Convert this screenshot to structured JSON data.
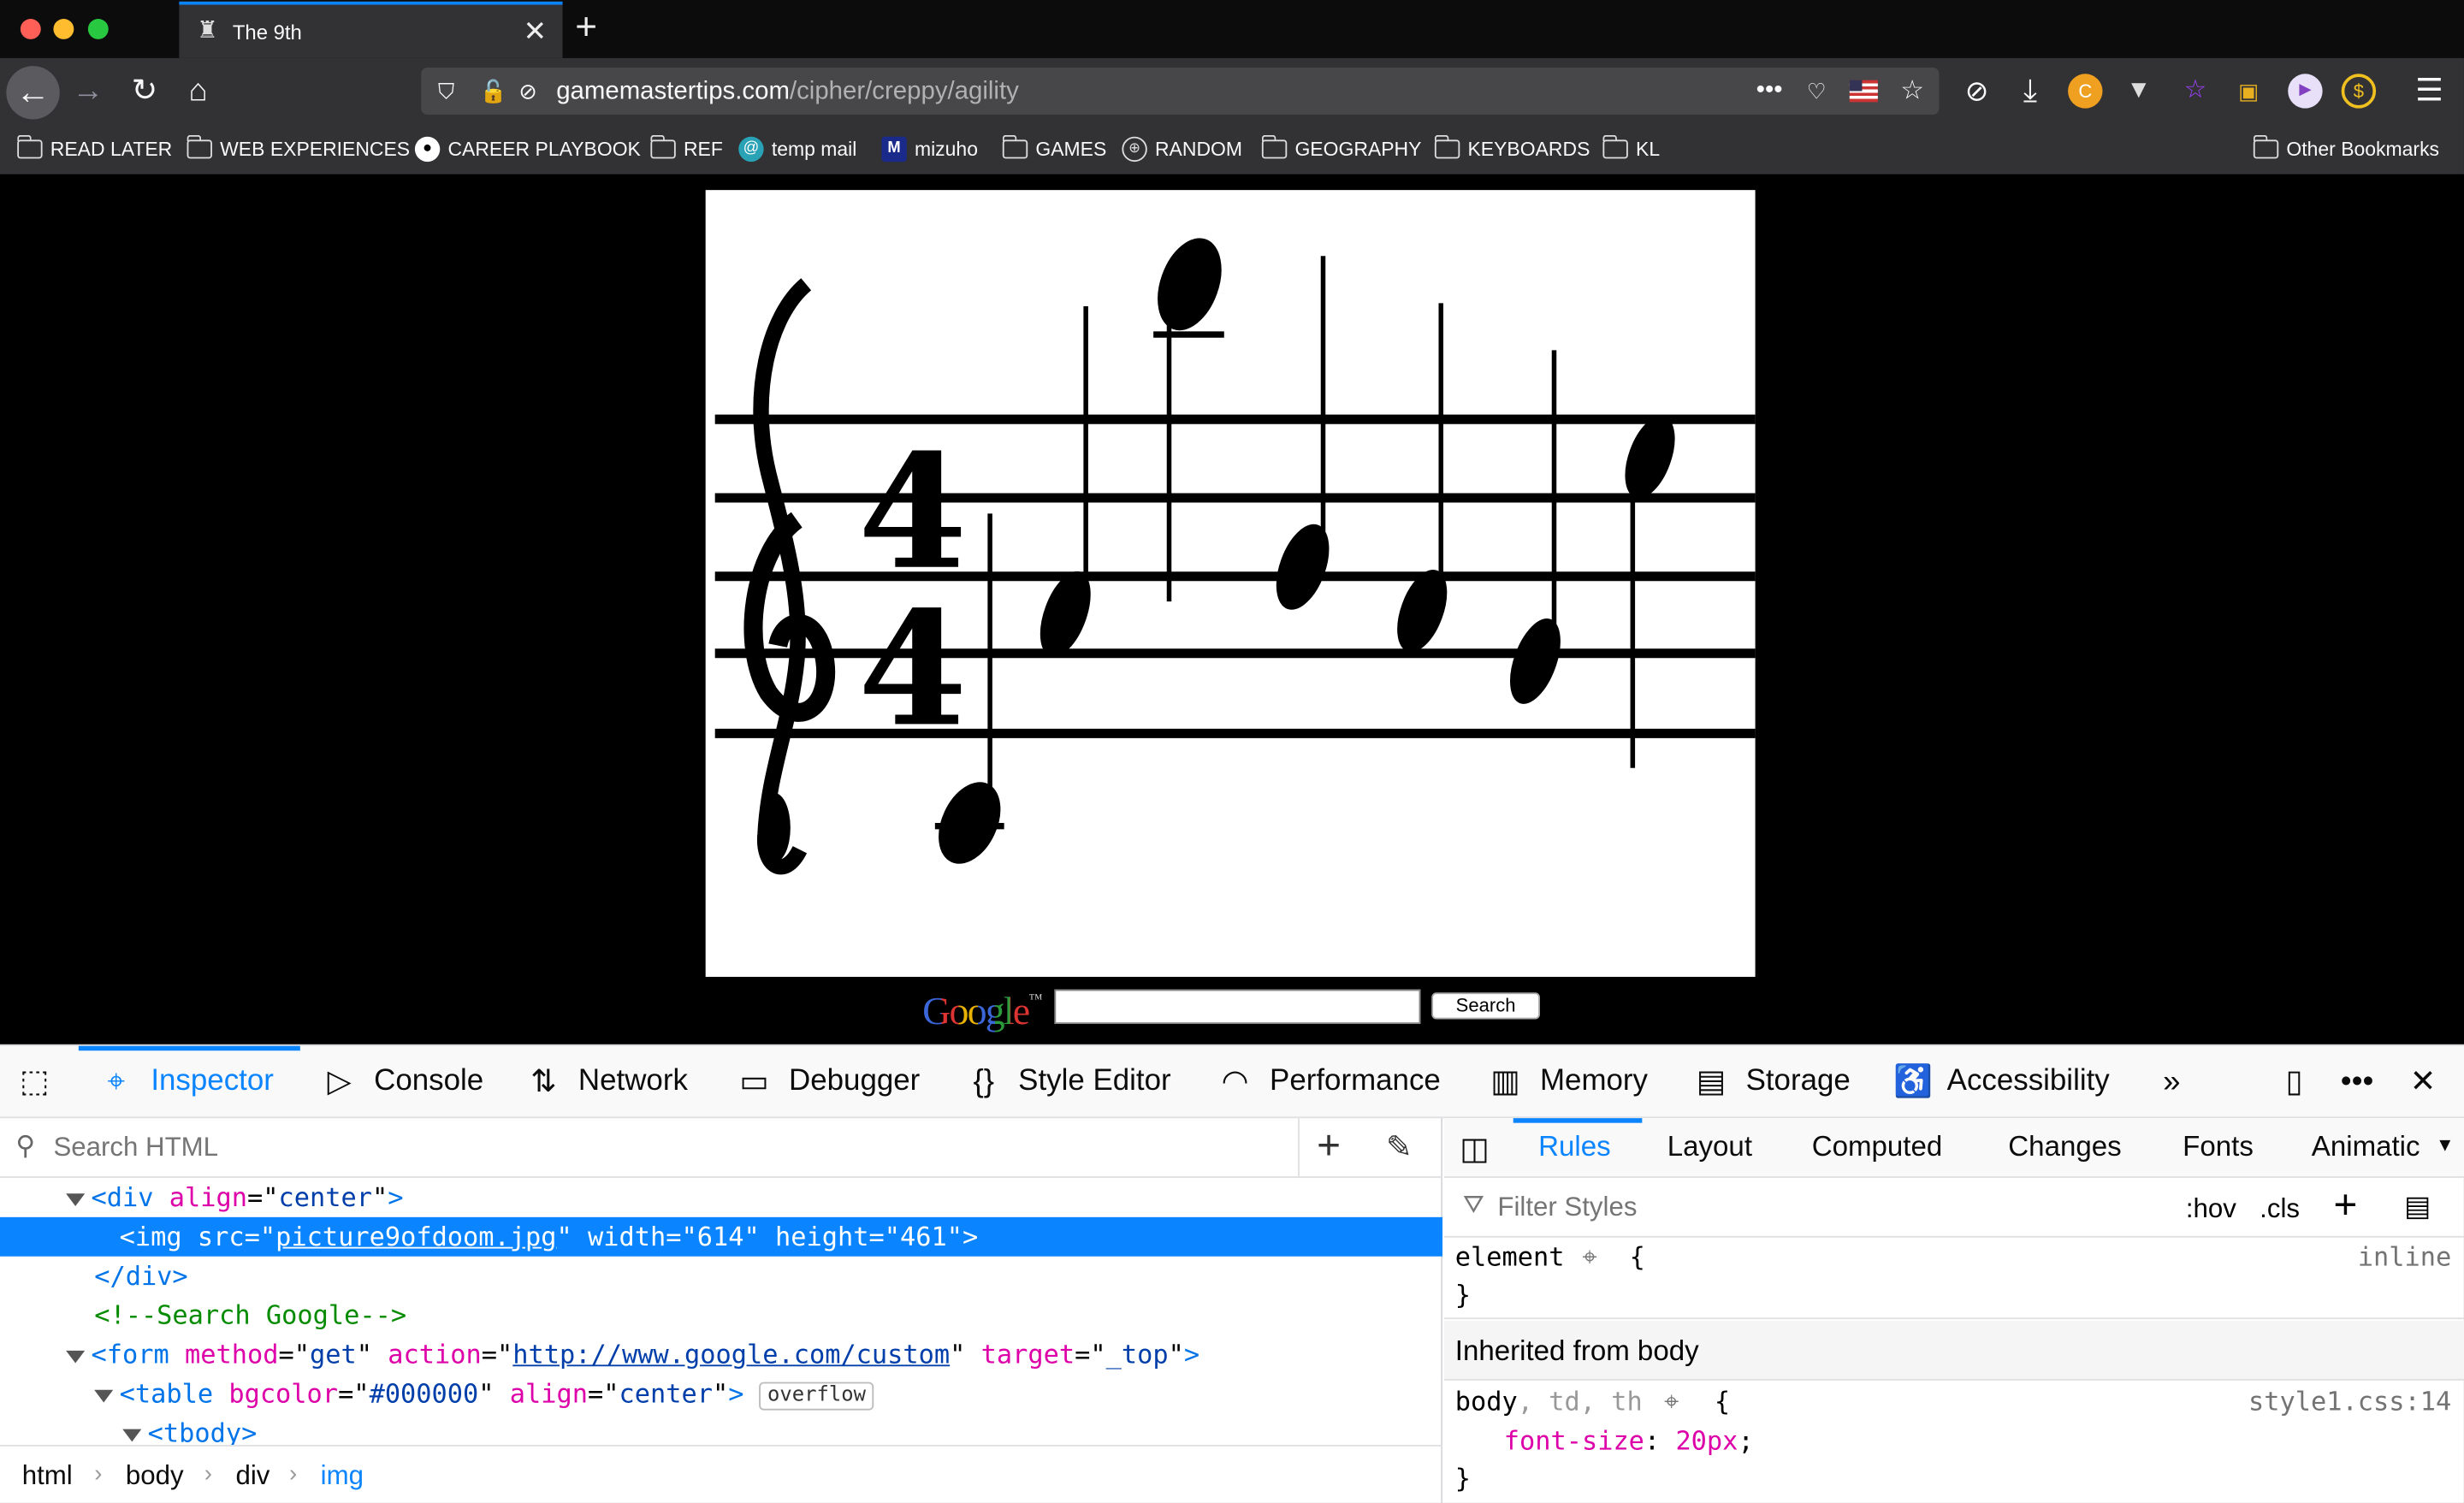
{
  "browser": {
    "tab_title": "The 9th",
    "url_domain": "gamemastertips.com",
    "url_path": "/cipher/creppy/agility",
    "bookmarks": [
      {
        "label": "READ LATER",
        "icon": "folder-icon"
      },
      {
        "label": "WEB EXPERIENCES",
        "icon": "folder-icon"
      },
      {
        "label": "CAREER PLAYBOOK",
        "icon": "github-icon"
      },
      {
        "label": "REF",
        "icon": "folder-icon"
      },
      {
        "label": "temp mail",
        "icon": "tempmail-icon"
      },
      {
        "label": "mizuho",
        "icon": "mizuho-icon"
      },
      {
        "label": "GAMES",
        "icon": "folder-icon"
      },
      {
        "label": "RANDOM",
        "icon": "globe-icon"
      },
      {
        "label": "GEOGRAPHY",
        "icon": "folder-icon"
      },
      {
        "label": "KEYBOARDS",
        "icon": "folder-icon"
      },
      {
        "label": "KL",
        "icon": "folder-icon"
      }
    ],
    "other_bookmarks": "Other Bookmarks"
  },
  "page": {
    "google_logo": "Google",
    "google_tm": "™",
    "search_button": "Search"
  },
  "devtools": {
    "tabs": [
      "Inspector",
      "Console",
      "Network",
      "Debugger",
      "Style Editor",
      "Performance",
      "Memory",
      "Storage",
      "Accessibility"
    ],
    "selected_tab": "Inspector",
    "search_placeholder": "Search HTML",
    "markup": {
      "line1_tag": "div",
      "line1_attr": "align",
      "line1_val": "center",
      "line2_tag": "img",
      "line2_src": "picture9ofdoom.jpg",
      "line2_width": "614",
      "line2_height": "461",
      "line3_close": "</div>",
      "line4_comment": "<!--Search Google-->",
      "line5_tag": "form",
      "line5_method": "get",
      "line5_action": "http://www.google.com/custom",
      "line5_target": "_top",
      "line6_tag": "table",
      "line6_bgcolor": "#000000",
      "line6_align": "center",
      "line6_badge": "overflow",
      "line7_tag": "tbody"
    },
    "breadcrumbs": [
      "html",
      "body",
      "div",
      "img"
    ],
    "rules_tabs": [
      "Rules",
      "Layout",
      "Computed",
      "Changes",
      "Fonts",
      "Animatic"
    ],
    "filter_placeholder": "Filter Styles",
    "hov": ":hov",
    "cls": ".cls",
    "rule_element_selector": "element",
    "rule_element_source": "inline",
    "inherited_header": "Inherited from body",
    "rule2_selector_main": "body",
    "rule2_selector_rest": ", td, th",
    "rule2_source": "style1.css:14",
    "rule2_prop": "font-size",
    "rule2_value": "20px"
  }
}
